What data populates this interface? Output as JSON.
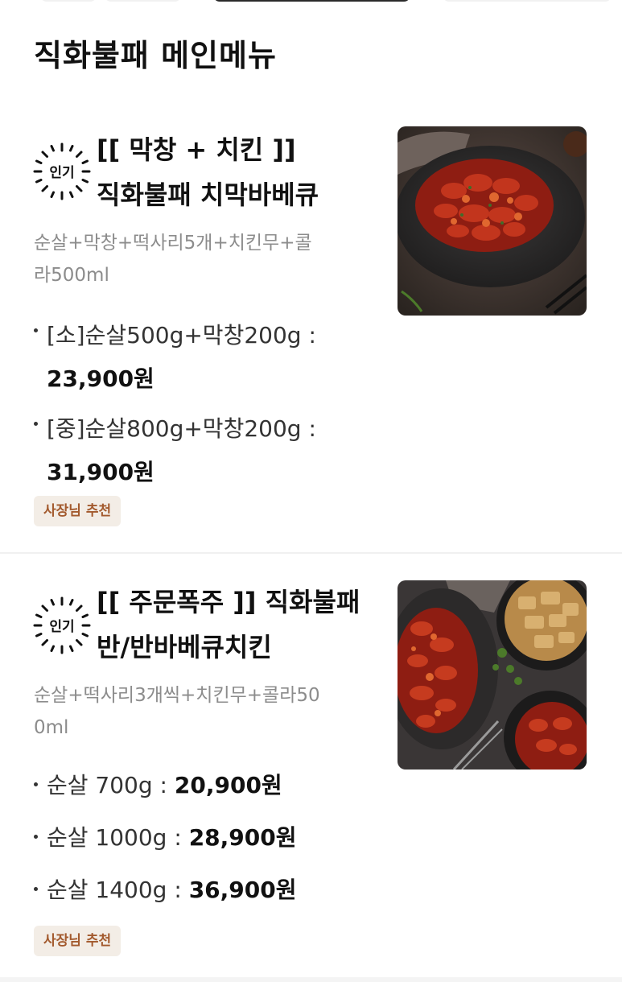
{
  "section": {
    "title": "직화불패 메인메뉴"
  },
  "badge_label": "인기",
  "items": [
    {
      "title_lines": [
        "[[ 막창 + 치킨 ]]",
        "직화불패 치막바베큐"
      ],
      "description_lines": [
        "순살+막창+떡사리5개+치킨무+콜",
        "라500ml"
      ],
      "options": [
        {
          "label": "[소]순살500g+막창200g :",
          "price": "23,900원"
        },
        {
          "label": "[중]순살800g+막창200g :",
          "price": "31,900원"
        }
      ],
      "tag": "사장님 추천"
    },
    {
      "title_lines": [
        "[[ 주문폭주 ]] 직화불패",
        "반/반바베큐치킨"
      ],
      "description_lines": [
        "순살+떡사리3개씩+치킨무+콜라50",
        "0ml"
      ],
      "options": [
        {
          "label": "순살 700g : ",
          "price": "20,900원"
        },
        {
          "label": "순살 1000g : ",
          "price": "28,900원"
        },
        {
          "label": "순살 1400g : ",
          "price": "36,900원"
        }
      ],
      "tag": "사장님 추천"
    }
  ],
  "colors": {
    "tag_background": "#f3ede6",
    "tag_text": "#a35a2e",
    "description": "#8c8c8c"
  }
}
